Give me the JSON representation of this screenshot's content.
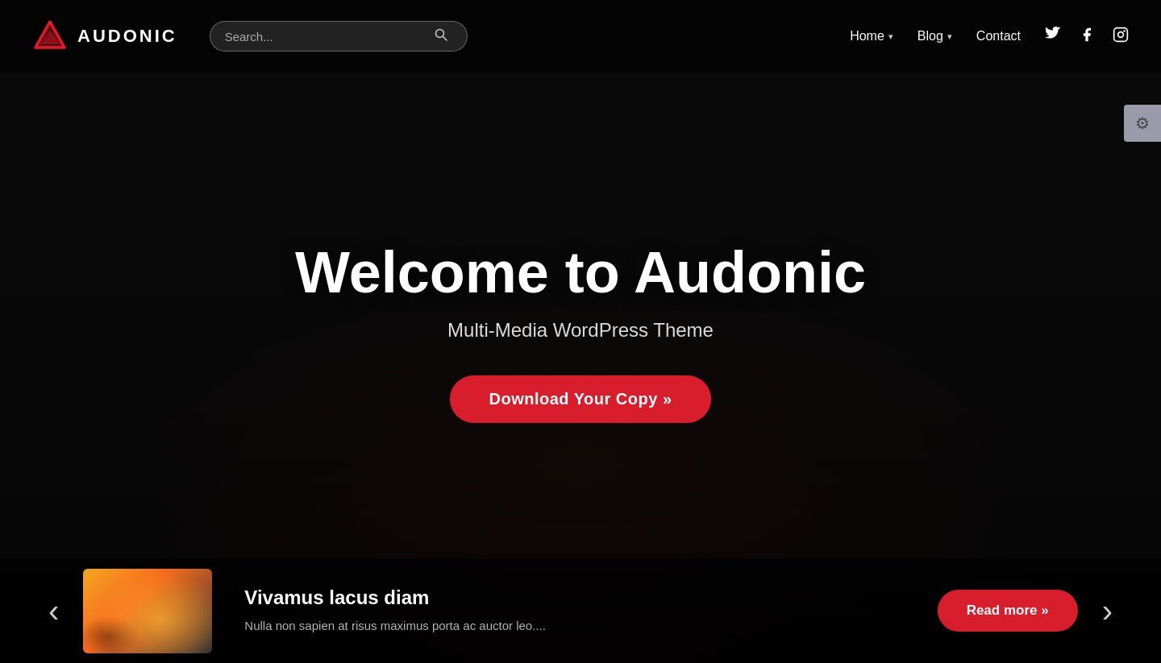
{
  "header": {
    "logo_text": "AUDONIC",
    "search_placeholder": "Search...",
    "nav_items": [
      {
        "label": "Home",
        "has_dropdown": true
      },
      {
        "label": "Blog",
        "has_dropdown": true
      },
      {
        "label": "Contact",
        "has_dropdown": false
      }
    ],
    "social": [
      "twitter",
      "facebook",
      "instagram"
    ]
  },
  "hero": {
    "title": "Welcome to Audonic",
    "subtitle": "Multi-Media WordPress Theme",
    "cta_label": "Download Your Copy »"
  },
  "bottom_strip": {
    "prev_label": "‹",
    "next_label": "›",
    "post_title": "Vivamus lacus diam",
    "post_excerpt": "Nulla non sapien at risus maximus porta ac auctor leo....",
    "read_more_label": "Read more »"
  },
  "gear_icon": "⚙"
}
